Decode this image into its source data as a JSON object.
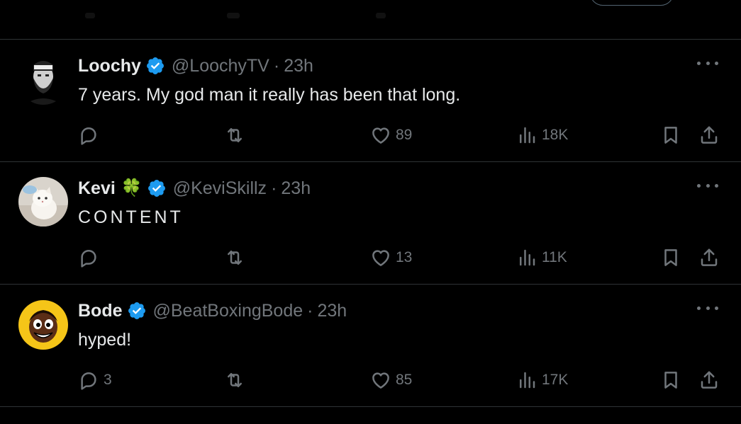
{
  "tweets": [
    {
      "name": "Loochy",
      "handle": "@LoochyTV",
      "separator": "·",
      "time": "23h",
      "text": "7 years. My god man it really has been that long.",
      "replies": "",
      "reposts": "",
      "likes": "89",
      "views": "18K",
      "avatar_desc": "bearded-man-avatar"
    },
    {
      "name": "Kevi",
      "emoji": "🍀",
      "handle": "@KeviSkillz",
      "separator": "·",
      "time": "23h",
      "text": "CONTENT",
      "replies": "",
      "reposts": "",
      "likes": "13",
      "views": "11K",
      "avatar_desc": "white-kitten-avatar"
    },
    {
      "name": "Bode",
      "handle": "@BeatBoxingBode",
      "separator": "·",
      "time": "23h",
      "text": "hyped!",
      "replies": "3",
      "reposts": "",
      "likes": "85",
      "views": "17K",
      "avatar_desc": "cartoon-face-avatar"
    }
  ],
  "colors": {
    "background": "#000000",
    "text": "#e7e9ea",
    "muted": "#71767b",
    "divider": "#2f3336",
    "verified": "#1d9bf0"
  }
}
